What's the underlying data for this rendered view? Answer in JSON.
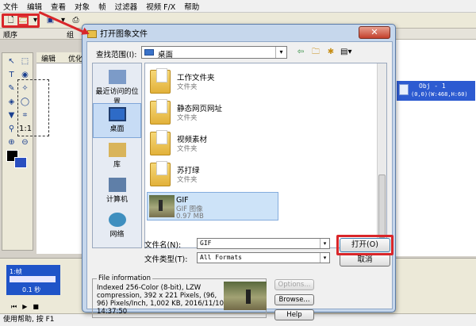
{
  "menubar": {
    "items": [
      "文件",
      "编辑",
      "查看",
      "对象",
      "帧",
      "过滤器",
      "视频 F/X",
      "帮助"
    ]
  },
  "panel": {
    "left_label": "顺序",
    "mid_label": "组"
  },
  "edit_tabs": {
    "tab1": "编辑",
    "tab2": "优化"
  },
  "object_panel": {
    "obj_name": "Obj - 1",
    "obj_detail": "(0,0)(W:468,H:60)"
  },
  "frames": {
    "frame_label": "1:帧",
    "frame_delay": "0.1 秒"
  },
  "status": {
    "text": "使用帮助, 按 F1"
  },
  "dialog": {
    "title": "打开图象文件",
    "lookin_label": "查找范围(I):",
    "lookin_value": "桌面",
    "places": [
      {
        "label": "最近访问的位置"
      },
      {
        "label": "桌面"
      },
      {
        "label": "库"
      },
      {
        "label": "计算机"
      },
      {
        "label": "网络"
      }
    ],
    "files": [
      {
        "name": "工作文件夹",
        "type": "文件夹"
      },
      {
        "name": "静态网页网址",
        "type": "文件夹"
      },
      {
        "name": "视频素材",
        "type": "文件夹"
      },
      {
        "name": "苏打绿",
        "type": "文件夹"
      }
    ],
    "selected_file": {
      "name": "GIF",
      "type": "GIF 图像",
      "size": "0.97 MB"
    },
    "filename_label": "文件名(N):",
    "filename_value": "GIF",
    "filetype_label": "文件类型(T):",
    "filetype_value": "All Formats",
    "open_label": "打开(O)",
    "cancel_label": "取消",
    "fileinfo_legend": "File information",
    "fileinfo_text": "Indexed 256-Color (8-bit), LZW compression, 392 x 221 Pixels, (96, 96) Pixels/Inch, 1,002 KB, 2016/11/10 14:37:50",
    "options_label": "Options...",
    "browse_label": "Browse...",
    "help_label": "Help"
  },
  "colors": {
    "highlight": "#d9262a",
    "selection": "#2d5bd1"
  },
  "icons": [
    "new-file-icon",
    "open-folder-icon",
    "save-icon",
    "back-arrow-icon",
    "up-folder-icon",
    "new-folder-icon",
    "view-menu-icon",
    "close-icon"
  ]
}
